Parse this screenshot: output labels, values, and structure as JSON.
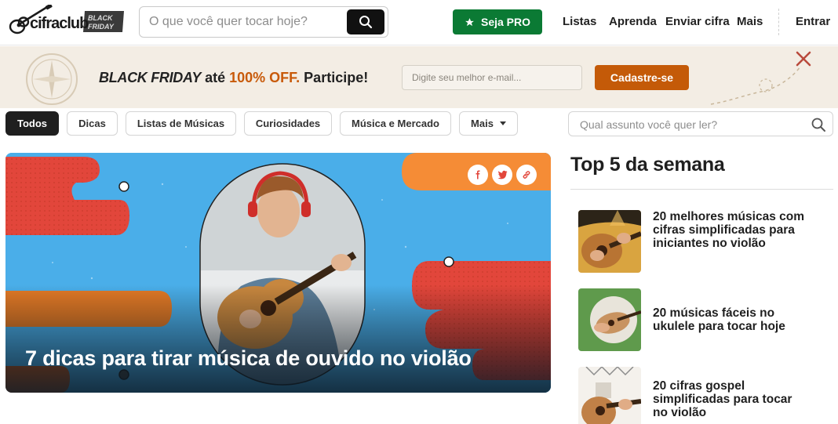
{
  "header": {
    "logo_text": "cifraclub",
    "logo_badge": "BLACK FRIDAY",
    "search_placeholder": "O que você quer tocar hoje?",
    "search_icon": "search-icon",
    "pro_label": "Seja PRO",
    "pro_icon": "star-icon",
    "nav": [
      "Listas",
      "Aprenda",
      "Enviar cifra",
      "Mais"
    ],
    "login_label": "Entrar"
  },
  "promo": {
    "black_friday": "BLACK FRIDAY",
    "ate": "até",
    "offer": "100% OFF.",
    "cta_text": "Participe!",
    "email_placeholder": "Digite seu melhor e-mail...",
    "signup_label": "Cadastre-se",
    "accent_color": "#c45a08"
  },
  "categories": {
    "items": [
      "Todos",
      "Dicas",
      "Listas de Músicas",
      "Curiosidades",
      "Música e Mercado",
      "Mais"
    ],
    "active": "Todos",
    "search_placeholder": "Qual assunto você quer ler?"
  },
  "hero": {
    "title": "7 dicas para tirar música de ouvido no violão",
    "share_icons": [
      "facebook-icon",
      "twitter-icon",
      "link-icon"
    ]
  },
  "top5": {
    "title": "Top 5 da semana",
    "items": [
      {
        "line1": "20 melhores músicas com",
        "line2": "cifras simplificadas para",
        "line3": "iniciantes no violão"
      },
      {
        "line1": "20 músicas fáceis no",
        "line2": "ukulele para tocar hoje",
        "line3": ""
      },
      {
        "line1": "20 cifras gospel",
        "line2": "simplificadas para tocar",
        "line3": "no violão"
      }
    ]
  },
  "colors": {
    "brand_green": "#0b7a34",
    "dark": "#1f1f1f",
    "promo_bg": "#f3ede4"
  }
}
